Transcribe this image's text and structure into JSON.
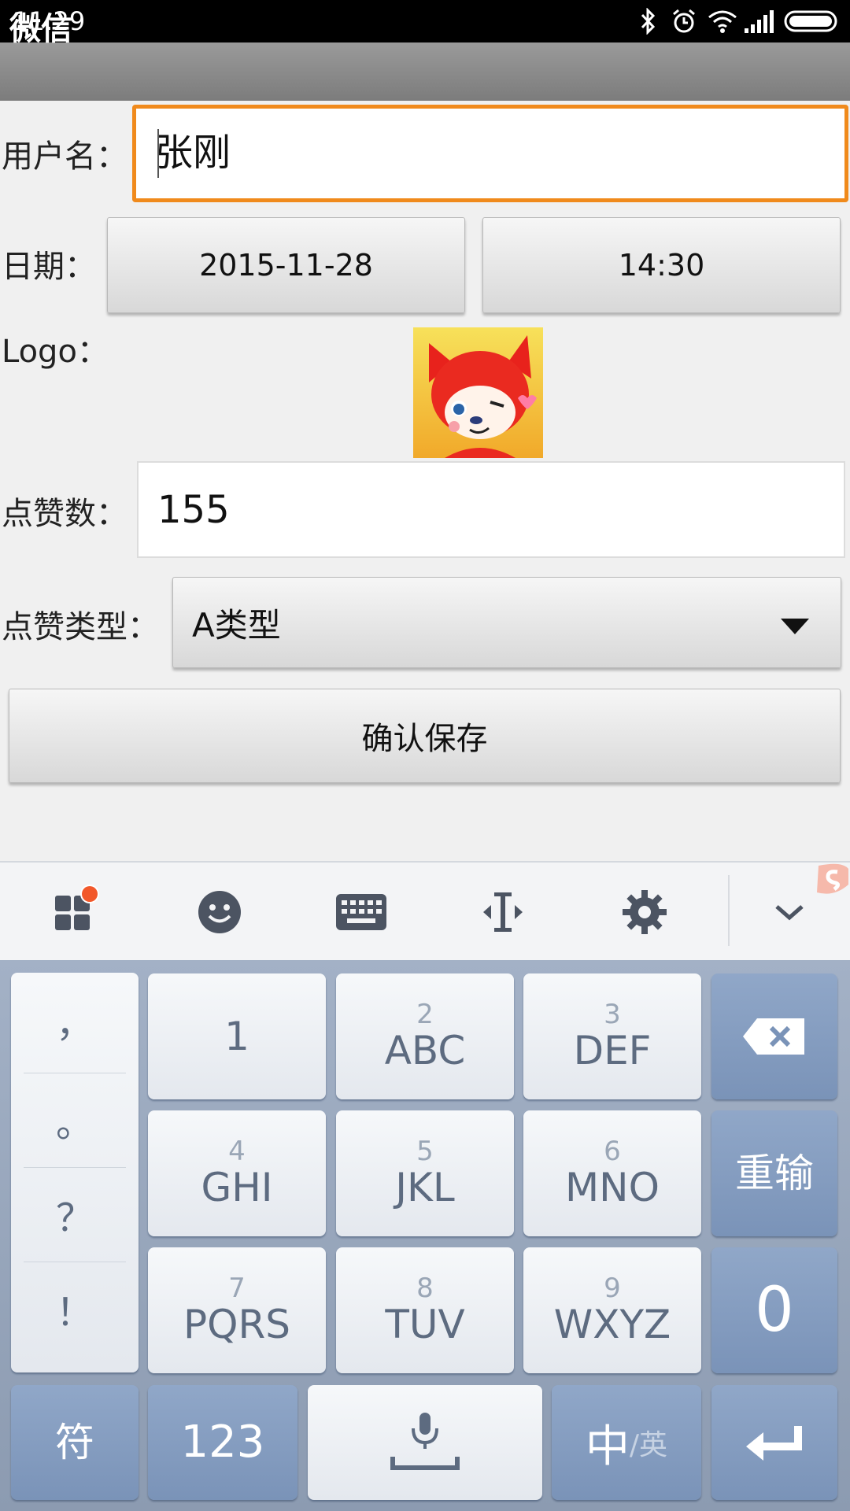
{
  "status_bar": {
    "time": "11:29",
    "icons": [
      "bluetooth-icon",
      "alarm-icon",
      "wifi-icon",
      "signal-icon",
      "battery-icon"
    ]
  },
  "app": {
    "title": "微信"
  },
  "form": {
    "username_label": "用户名：",
    "username_value": "张刚",
    "date_label": "日期：",
    "date_value": "2015-11-28",
    "time_value": "14:30",
    "logo_label": "Logo：",
    "likes_label": "点赞数：",
    "likes_value": "155",
    "like_type_label": "点赞类型：",
    "like_type_value": "A类型",
    "save_label": "确认保存"
  },
  "keyboard": {
    "toolbar_icons": [
      "apps-icon",
      "emoji-icon",
      "keyboard-icon",
      "cursor-icon",
      "settings-icon",
      "collapse-icon"
    ],
    "punctuation": [
      "，",
      "。",
      "？",
      "！"
    ],
    "keys": [
      {
        "num": "",
        "letters": "1"
      },
      {
        "num": "2",
        "letters": "ABC"
      },
      {
        "num": "3",
        "letters": "DEF"
      },
      {
        "num": "4",
        "letters": "GHI"
      },
      {
        "num": "5",
        "letters": "JKL"
      },
      {
        "num": "6",
        "letters": "MNO"
      },
      {
        "num": "7",
        "letters": "PQRS"
      },
      {
        "num": "8",
        "letters": "TUV"
      },
      {
        "num": "9",
        "letters": "WXYZ"
      }
    ],
    "reenter_label": "重输",
    "zero_label": "0",
    "symbols_label": "符",
    "numbers_label": "123",
    "lang_main": "中",
    "lang_alt": "/英",
    "colors": {
      "accent": "#f08a1c",
      "keyboard_dark": "#7a93b8"
    }
  }
}
